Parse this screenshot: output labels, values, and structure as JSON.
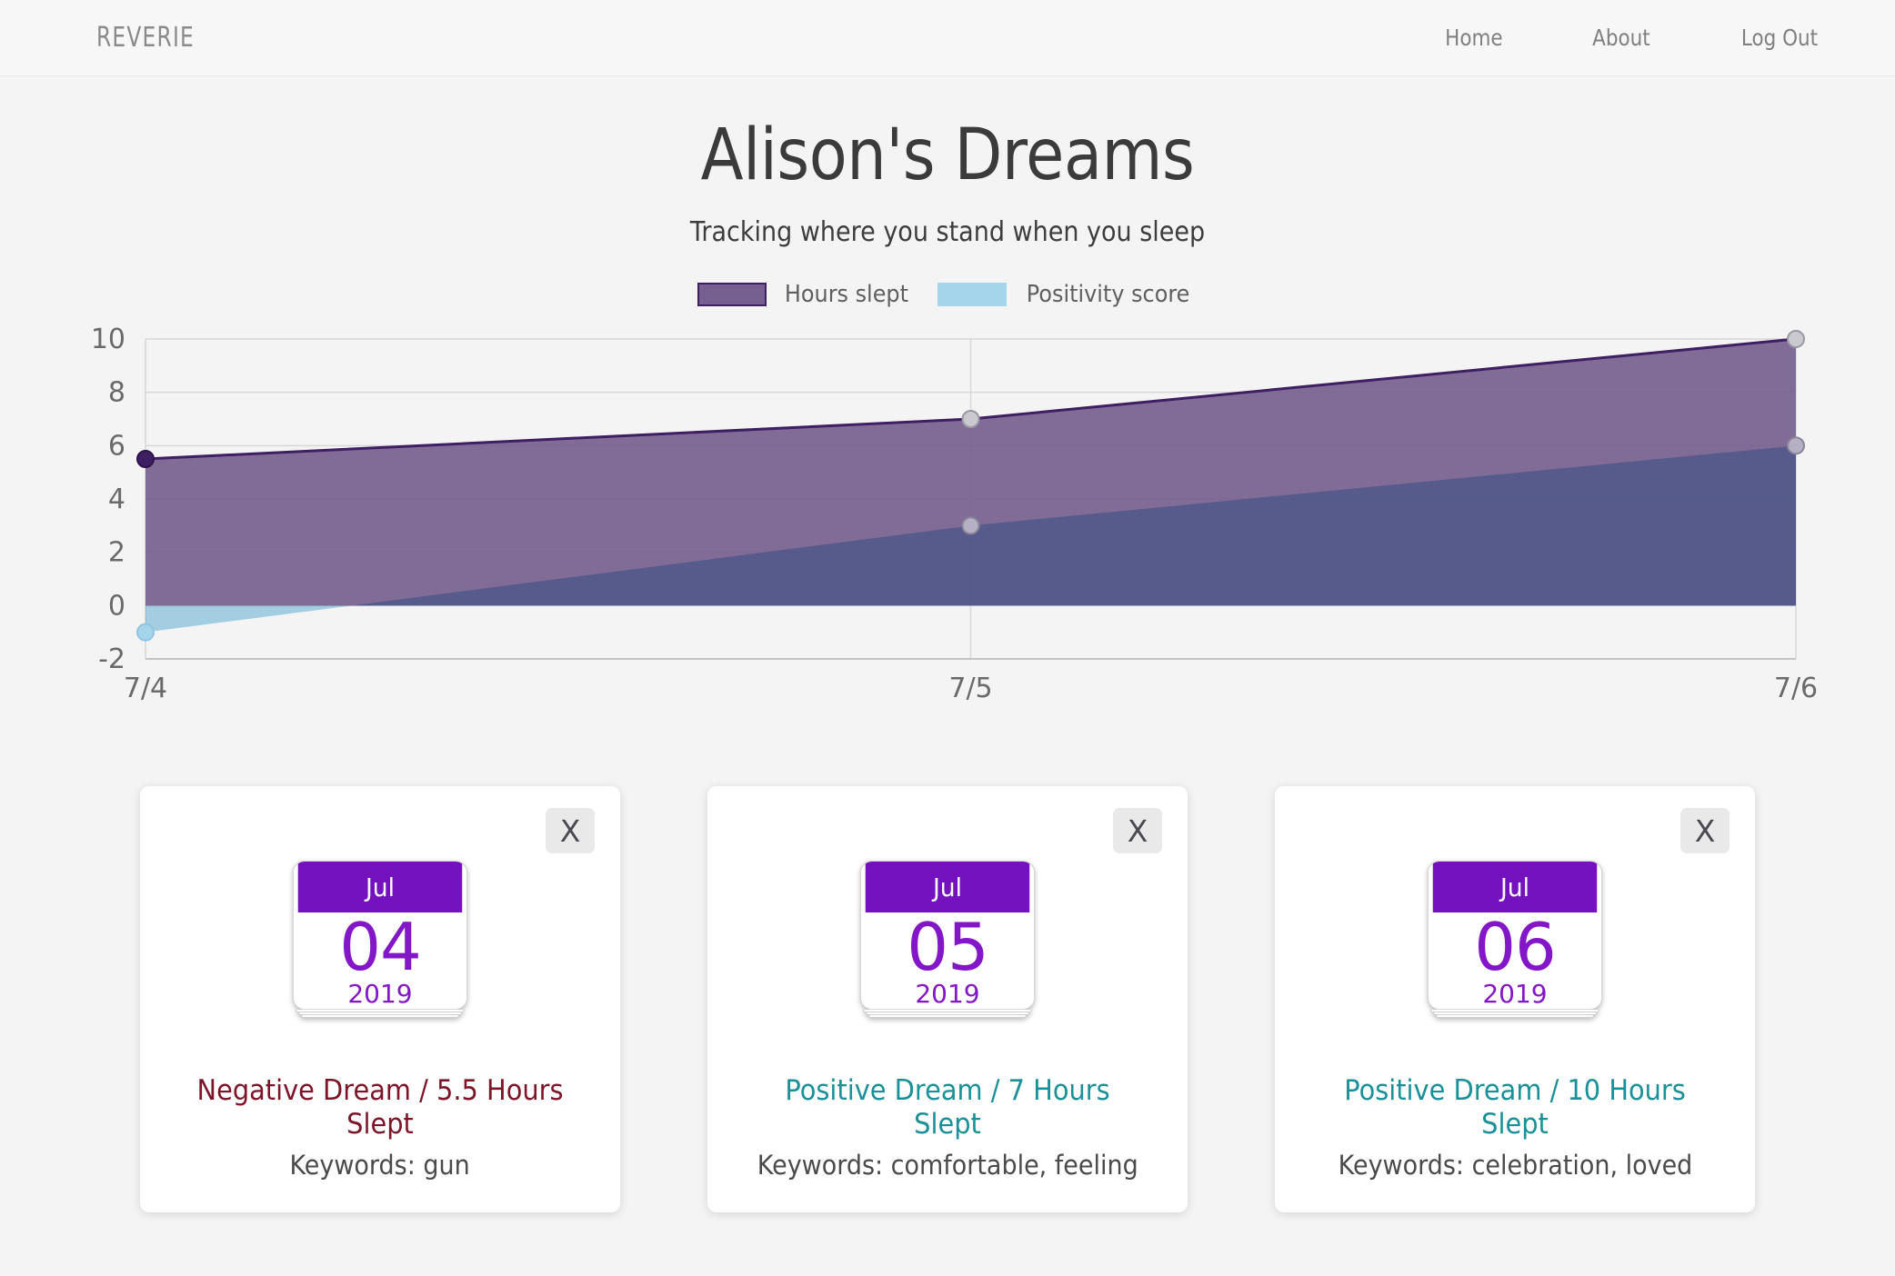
{
  "navbar": {
    "brand": "REVERIE",
    "links": [
      {
        "label": "Home"
      },
      {
        "label": "About"
      },
      {
        "label": "Log Out"
      }
    ]
  },
  "header": {
    "title": "Alison's Dreams",
    "subtitle": "Tracking where you stand when you sleep"
  },
  "colors": {
    "hours_area": "#76608f",
    "hours_line": "#3f1f63",
    "positivity_area": "#a5d5ea",
    "overlap_area": "#51548d",
    "calendar_purple": "#7312be",
    "negative_text": "#7d1428",
    "positive_text": "#1a9098"
  },
  "chart_data": {
    "type": "area",
    "title": "",
    "xlabel": "",
    "ylabel": "",
    "x": [
      "7/4",
      "7/5",
      "7/6"
    ],
    "xticks": [
      "7/4",
      "7/5",
      "7/6"
    ],
    "yticks": [
      10,
      8,
      6,
      4,
      2,
      0,
      -2
    ],
    "ylim": [
      -2,
      10
    ],
    "grid": true,
    "legend_position": "top-center",
    "series": [
      {
        "name": "Hours slept",
        "values": [
          5.5,
          7,
          10
        ],
        "color": "#76608f"
      },
      {
        "name": "Positivity score",
        "values": [
          -1,
          3,
          6
        ],
        "color": "#a5d5ea"
      }
    ]
  },
  "legend": {
    "items": [
      {
        "label": "Hours slept",
        "swatch": "hours"
      },
      {
        "label": "Positivity score",
        "swatch": "positivity"
      }
    ]
  },
  "cards": [
    {
      "close_label": "X",
      "month": "Jul",
      "day": "04",
      "year": "2019",
      "title": "Negative Dream / 5.5 Hours Slept",
      "keywords": "Keywords: gun",
      "sentiment": "negative"
    },
    {
      "close_label": "X",
      "month": "Jul",
      "day": "05",
      "year": "2019",
      "title": "Positive Dream / 7 Hours Slept",
      "keywords": "Keywords: comfortable, feeling",
      "sentiment": "positive"
    },
    {
      "close_label": "X",
      "month": "Jul",
      "day": "06",
      "year": "2019",
      "title": "Positive Dream / 10 Hours Slept",
      "keywords": "Keywords: celebration, loved",
      "sentiment": "positive"
    }
  ]
}
